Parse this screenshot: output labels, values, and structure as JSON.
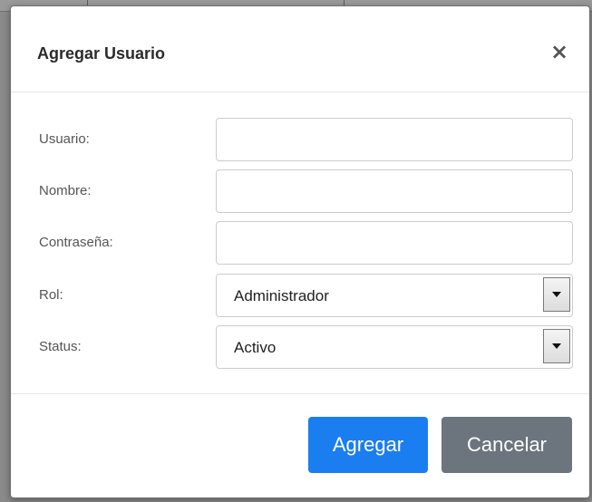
{
  "modal": {
    "title": "Agregar Usuario",
    "close_label": "×"
  },
  "form": {
    "usuario": {
      "label": "Usuario:",
      "value": ""
    },
    "nombre": {
      "label": "Nombre:",
      "value": ""
    },
    "contrasena": {
      "label": "Contraseña:",
      "value": ""
    },
    "rol": {
      "label": "Rol:",
      "selected": "Administrador"
    },
    "status": {
      "label": "Status:",
      "selected": "Activo"
    }
  },
  "footer": {
    "submit_label": "Agregar",
    "cancel_label": "Cancelar"
  },
  "colors": {
    "primary": "#1a7ef0",
    "secondary": "#6c757d",
    "backdrop": "#8a8a8a"
  },
  "icons": {
    "close": "close-icon",
    "select_arrow": "chevron-down-icon"
  }
}
